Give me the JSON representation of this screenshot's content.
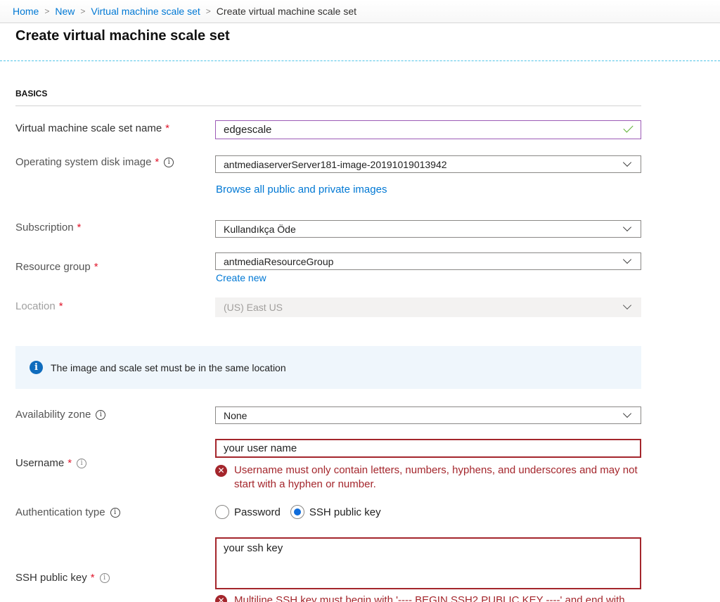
{
  "breadcrumb": {
    "items": [
      {
        "label": "Home",
        "link": true
      },
      {
        "label": "New",
        "link": true
      },
      {
        "label": "Virtual machine scale set",
        "link": true
      },
      {
        "label": "Create virtual machine scale set",
        "link": false
      }
    ],
    "separator": ">"
  },
  "page": {
    "title": "Create virtual machine scale set"
  },
  "section": {
    "heading": "BASICS"
  },
  "form": {
    "required_marker": "*",
    "info_glyph": "i",
    "vmss_name": {
      "label": "Virtual machine scale set name",
      "value": "edgescale",
      "status": "valid",
      "status_icon": "check-icon"
    },
    "os_disk_image": {
      "label": "Operating system disk image",
      "value": "antmediaserverServer181-image-20191019013942",
      "browse_link": "Browse all public and private images"
    },
    "subscription": {
      "label": "Subscription",
      "value": "Kullandıkça Öde"
    },
    "resource_group": {
      "label": "Resource group",
      "value": "antmediaResourceGroup",
      "create_link": "Create new"
    },
    "location": {
      "label": "Location",
      "value": "(US) East US",
      "disabled": true
    },
    "info_banner": {
      "icon": "info-icon",
      "glyph": "i",
      "text": "The image and scale set must be in the same location"
    },
    "availability_zone": {
      "label": "Availability zone",
      "value": "None"
    },
    "username": {
      "label": "Username",
      "value": "your user name",
      "error": "Username must only contain letters, numbers, hyphens, and underscores and may not start with a hyphen or number."
    },
    "auth_type": {
      "label": "Authentication type",
      "options": [
        {
          "label": "Password",
          "checked": false
        },
        {
          "label": "SSH public key",
          "checked": true
        }
      ]
    },
    "ssh_key": {
      "label": "SSH public key",
      "value": "your ssh key",
      "error": "Multiline SSH key must begin with '---- BEGIN SSH2 PUBLIC KEY ----' and end with"
    },
    "error_glyph": "✕"
  },
  "colors": {
    "link": "#0078d4",
    "required": "#e0162b",
    "error": "#a4262c",
    "valid": "#5fb234",
    "focus_border": "#9c5bb6",
    "info_bg": "#eff6fc",
    "radio_selected": "#0f6cdb"
  }
}
